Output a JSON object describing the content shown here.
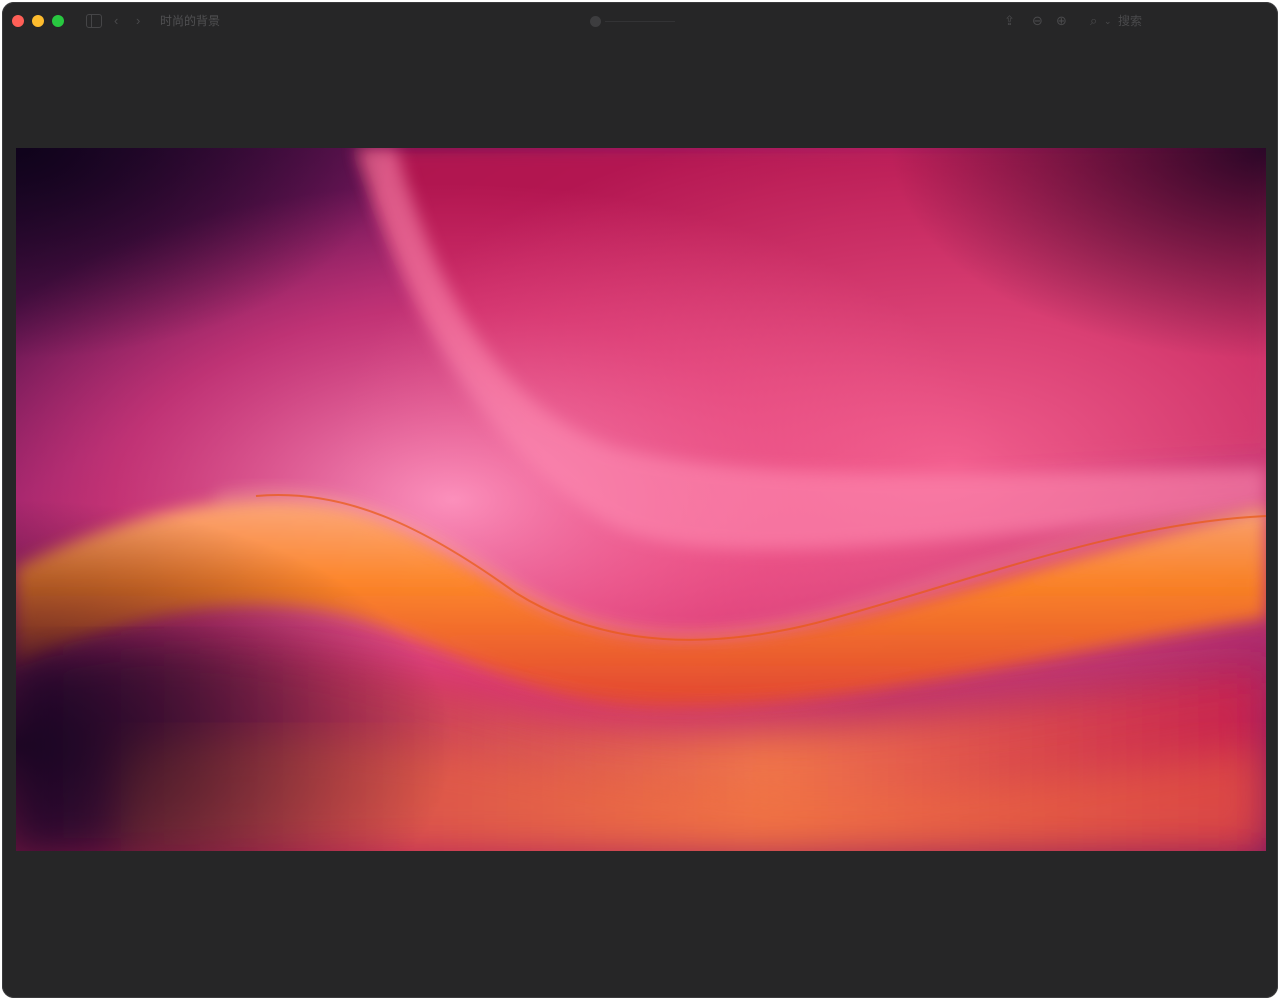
{
  "window": {
    "title": "时尚的背景",
    "search_label": "搜索"
  },
  "toolbar": {
    "back_glyph": "‹",
    "forward_glyph": "›",
    "share_glyph": "⇪",
    "zoom_out_glyph": "⊖",
    "zoom_in_glyph": "⊕",
    "search_glyph": "⌕",
    "chevron_glyph": "⌄"
  },
  "colors": {
    "window_bg": "#262627",
    "close": "#ff5f57",
    "minimize": "#febc2e",
    "maximize": "#28c840",
    "wallpaper_magenta": "#c2185b",
    "wallpaper_pink": "#f48fb1",
    "wallpaper_orange": "#ff8a00",
    "wallpaper_purple": "#4a1045"
  }
}
